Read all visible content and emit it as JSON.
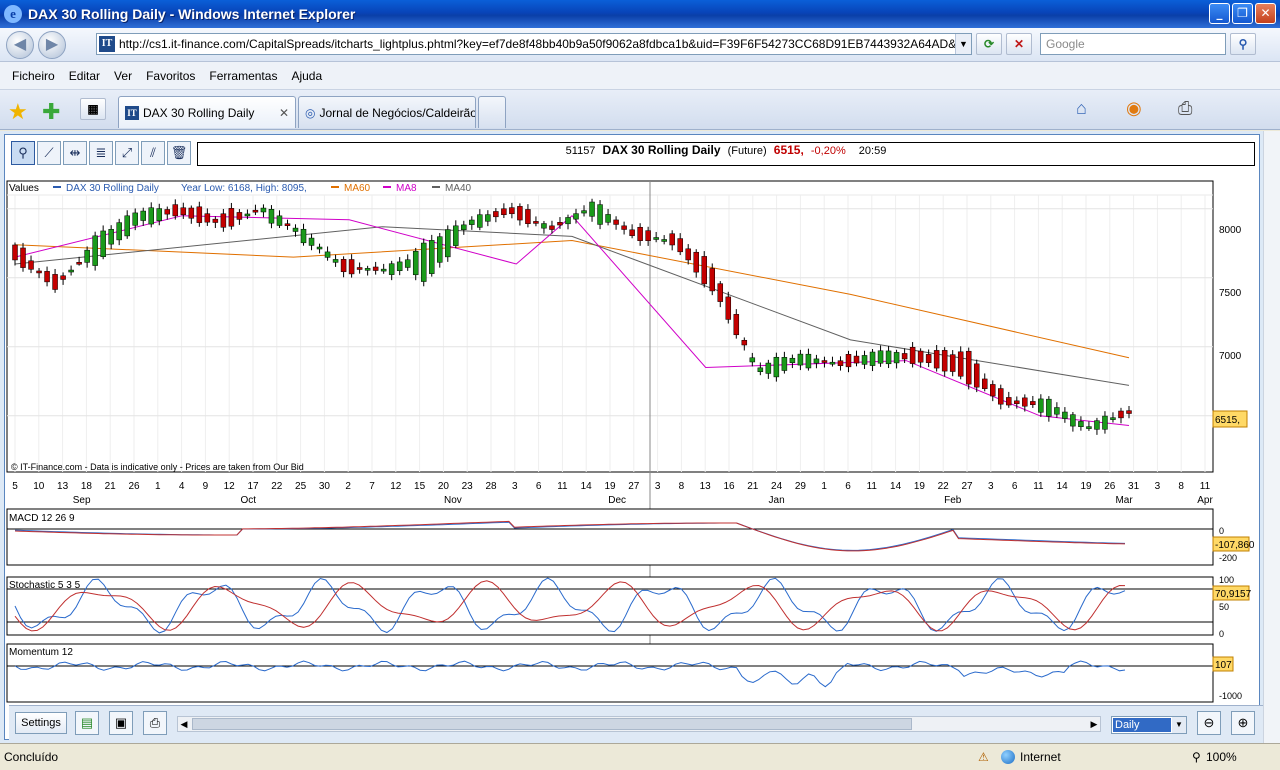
{
  "window": {
    "title": "DAX 30 Rolling Daily - Windows Internet Explorer",
    "address": "http://cs1.it-finance.com/CapitalSpreads/itcharts_lightplus.phtml?key=ef7de8f48bb40b9a50f9062a8fdbca1b&uid=F39F6F54273CC68D91EB7443932A64AD&id=51157",
    "search_placeholder": "Google"
  },
  "menu": [
    "Ficheiro",
    "Editar",
    "Ver",
    "Favoritos",
    "Ferramentas",
    "Ajuda"
  ],
  "tabs": [
    {
      "label": "DAX 30 Rolling Daily",
      "active": true
    },
    {
      "label": "Jornal de Negócios/Caldeirão...",
      "active": false
    }
  ],
  "header": {
    "id": "51157",
    "name": "DAX 30  Rolling Daily",
    "type": "(Future)",
    "price": "6515,",
    "change": "-0,20%",
    "time": "20:59"
  },
  "main_panel": {
    "legend_values": "Values",
    "legend_series": "DAX 30  Rolling Daily",
    "legend_range": "Year Low: 6168, High: 8095,",
    "legend_ma60": "MA60",
    "legend_ma8": "MA8",
    "legend_ma40": "MA40",
    "copyright": "© IT-Finance.com - Data is indicative only - Prices are taken from Our Bid",
    "price_label": "6515,",
    "y_ticks": [
      "8000",
      "7500",
      "7000"
    ]
  },
  "date_axis": {
    "days": [
      "5",
      "10",
      "13",
      "18",
      "21",
      "26",
      "1",
      "4",
      "9",
      "12",
      "17",
      "22",
      "25",
      "30",
      "2",
      "7",
      "12",
      "15",
      "20",
      "23",
      "28",
      "3",
      "6",
      "11",
      "14",
      "19",
      "27",
      "3",
      "8",
      "13",
      "16",
      "21",
      "24",
      "29",
      "1",
      "6",
      "11",
      "14",
      "19",
      "22",
      "27",
      "3",
      "6",
      "11",
      "14",
      "19",
      "26",
      "31",
      "3",
      "8",
      "11"
    ],
    "months": [
      "Sep",
      "Oct",
      "Nov",
      "Dec",
      "Jan",
      "Feb",
      "Mar",
      "Apr"
    ]
  },
  "macd": {
    "title": "MACD 12 26 9",
    "value": "-107,860",
    "tick_0": "0",
    "tick_m200": "-200"
  },
  "stochastic": {
    "title": "Stochastic 5 3 5",
    "value": "70,9157",
    "tick_100": "100",
    "tick_50": "50",
    "tick_0": "0"
  },
  "momentum": {
    "title": "Momentum 12",
    "value": "107",
    "tick": "-1000"
  },
  "bottom": {
    "settings": "Settings",
    "period": "Daily"
  },
  "status": {
    "left": "Concluído",
    "zone": "Internet",
    "zoom": "100%"
  },
  "colors": {
    "up": "#1a9a1a",
    "down": "#c40000",
    "ma60": "#e07000",
    "ma8": "#d000c8",
    "ma40": "#606060",
    "macd": "#2a6acc",
    "signal": "#c03030"
  },
  "chart_data": {
    "type": "candlestick",
    "series_name": "DAX 30  Rolling Daily",
    "ylim": [
      6100,
      8100
    ],
    "x_range": [
      "Sep 5",
      "Apr 11"
    ],
    "ohlc_approx": [
      [
        "Sep 3",
        7720,
        7640
      ],
      [
        "Sep 10",
        7500,
        7420
      ],
      [
        "Sep 18",
        7640,
        7800
      ],
      [
        "Sep 26",
        7880,
        8000
      ],
      [
        "Oct 10",
        8020,
        7960
      ],
      [
        "Oct 17",
        7960,
        7860
      ],
      [
        "Oct 30",
        7980,
        8010
      ],
      [
        "Nov 7",
        7770,
        7840
      ],
      [
        "Nov 14",
        7600,
        7550
      ],
      [
        "Nov 23",
        7560,
        7560
      ],
      [
        "Nov 28",
        7500,
        7750
      ],
      [
        "Dec 6",
        7850,
        7930
      ],
      [
        "Dec 14",
        8030,
        7960
      ],
      [
        "Dec 20",
        7870,
        7850
      ],
      [
        "Dec 27",
        7950,
        8050
      ],
      [
        "Jan 3",
        7850,
        7790
      ],
      [
        "Jan 10",
        7790,
        7750
      ],
      [
        "Jan 16",
        7570,
        7350
      ],
      [
        "Jan 22",
        6800,
        6850
      ],
      [
        "Jan 29",
        6850,
        6960
      ],
      [
        "Feb 6",
        6920,
        6850
      ],
      [
        "Feb 13",
        6870,
        6980
      ],
      [
        "Feb 20",
        6980,
        6880
      ],
      [
        "Feb 27",
        6960,
        6780
      ],
      [
        "Mar 5",
        6650,
        6570
      ],
      [
        "Mar 12",
        6540,
        6610
      ],
      [
        "Mar 19",
        6380,
        6440
      ],
      [
        "Mar 26",
        6540,
        6515
      ]
    ],
    "ma60_approx": [
      [
        0,
        7740
      ],
      [
        0.25,
        7650
      ],
      [
        0.5,
        7770
      ],
      [
        0.75,
        7380
      ],
      [
        1,
        6920
      ]
    ],
    "ma40_approx": [
      [
        0,
        7600
      ],
      [
        0.33,
        7870
      ],
      [
        0.5,
        7800
      ],
      [
        0.75,
        7050
      ],
      [
        1,
        6720
      ]
    ],
    "ma8_approx": [
      [
        0,
        7650
      ],
      [
        0.15,
        7950
      ],
      [
        0.3,
        7920
      ],
      [
        0.45,
        7600
      ],
      [
        0.5,
        7950
      ],
      [
        0.62,
        6850
      ],
      [
        0.8,
        6900
      ],
      [
        0.92,
        6500
      ],
      [
        1,
        6430
      ]
    ]
  }
}
